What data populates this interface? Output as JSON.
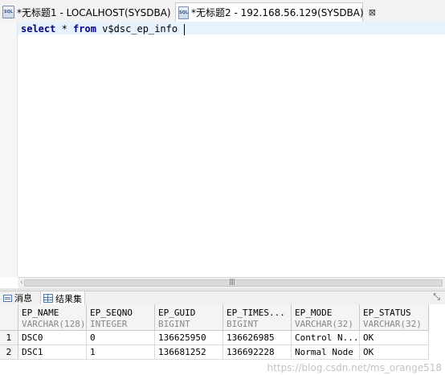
{
  "tabs": [
    {
      "label": "*无标题1 - LOCALHOST(SYSDBA)",
      "icon": "sql-file-icon",
      "active": false
    },
    {
      "label": "*无标题2 - 192.168.56.129(SYSDBA)",
      "icon": "sql-file-icon",
      "active": true,
      "close_glyph": "⊠"
    }
  ],
  "editor": {
    "kw_select": "select",
    "star": " * ",
    "kw_from": "from",
    "rest": " v$dsc_ep_info "
  },
  "scrollbar": {
    "left_arrow": "‹",
    "grip": "||||"
  },
  "bottom_tabs": [
    {
      "label": "消息",
      "icon": "message-icon"
    },
    {
      "label": "结果集",
      "icon": "grid-icon"
    }
  ],
  "view_action_glyph": "⤡",
  "result": {
    "columns": [
      {
        "name": "EP_NAME",
        "type": "VARCHAR(128)"
      },
      {
        "name": "EP_SEQNO",
        "type": "INTEGER"
      },
      {
        "name": "EP_GUID",
        "type": "BIGINT"
      },
      {
        "name": "EP_TIMES...",
        "type": "BIGINT"
      },
      {
        "name": "EP_MODE",
        "type": "VARCHAR(32)"
      },
      {
        "name": "EP_STATUS",
        "type": "VARCHAR(32)"
      }
    ],
    "rows": [
      {
        "num": "1",
        "cells": [
          "DSC0",
          "0",
          "136625950",
          "136626985",
          "Control N...",
          "OK"
        ]
      },
      {
        "num": "2",
        "cells": [
          "DSC1",
          "1",
          "136681252",
          "136692228",
          "Normal Node",
          "OK"
        ]
      }
    ]
  },
  "watermark": "https://blog.csdn.net/ms_orange518"
}
